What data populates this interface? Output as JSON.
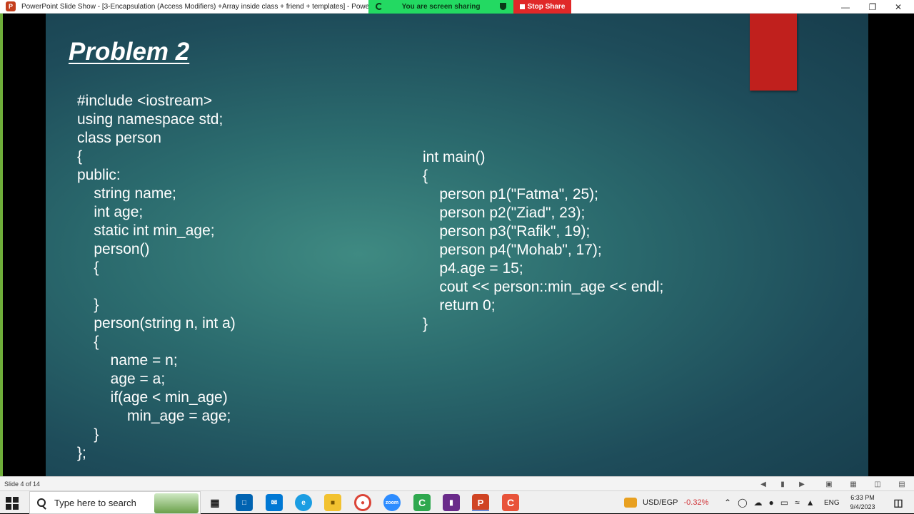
{
  "window": {
    "app_icon_letter": "P",
    "title": "PowerPoint Slide Show - [3-Encapsulation (Access Modifiers) +Array inside class + friend + templates] - PowerPoint",
    "sharing_label": "You are screen sharing",
    "stop_share_label": "Stop Share"
  },
  "slide": {
    "title": "Problem 2",
    "left_code": [
      "#include <iostream>",
      "using namespace std;",
      "class person",
      "{",
      "public:",
      "    string name;",
      "    int age;",
      "    static int min_age;",
      "    person()",
      "    {",
      "",
      "    }",
      "    person(string n, int a)",
      "    {",
      "        name = n;",
      "        age = a;",
      "        if(age < min_age)",
      "            min_age = age;",
      "    }",
      "};"
    ],
    "right_code": [
      "int main()",
      "{",
      "    person p1(\"Fatma\", 25);",
      "    person p2(\"Ziad\", 23);",
      "    person p3(\"Rafik\", 19);",
      "    person p4(\"Mohab\", 17);",
      "    p4.age = 15;",
      "    cout << person::min_age << endl;",
      "    return 0;",
      "}"
    ]
  },
  "statusbar": {
    "slide_counter": "Slide 4 of 14"
  },
  "taskbar": {
    "search_placeholder": "Type here to search",
    "currency_label": "USD/EGP",
    "currency_change": "-0.32%",
    "language": "ENG",
    "time": "6:33 PM",
    "date": "9/4/2023"
  },
  "colors": {
    "slide_bg": "#2b6b6e",
    "red_tab": "#c0201d",
    "share_green": "#23d962",
    "stop_red": "#e02828",
    "currency_change_color": "#d13438"
  }
}
